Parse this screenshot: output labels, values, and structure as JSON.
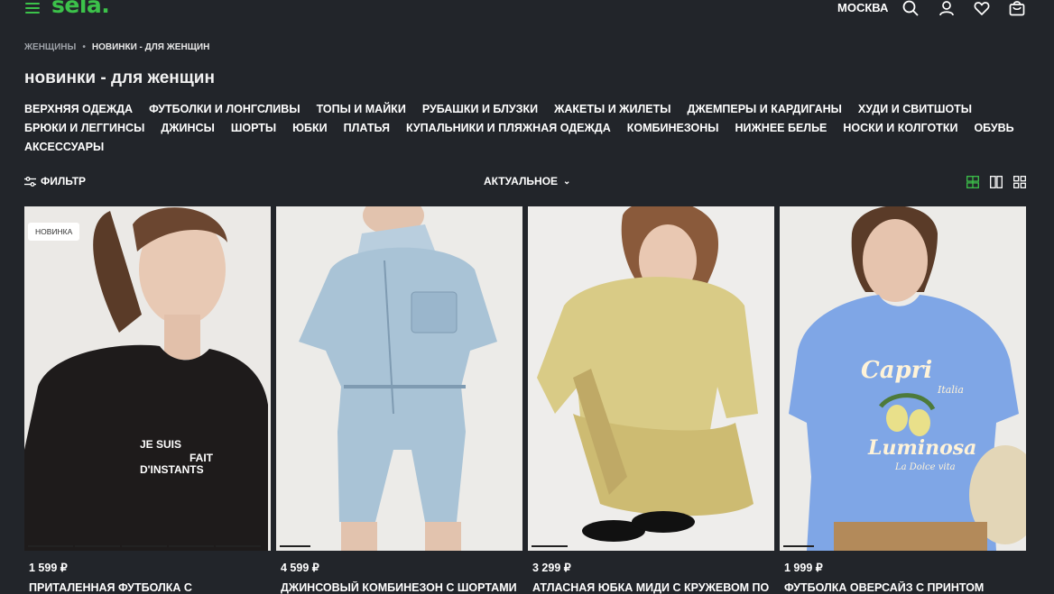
{
  "header": {
    "logo": "sela.",
    "city": "МОСКВА",
    "icons": [
      "burger-menu-icon",
      "search-icon",
      "user-icon",
      "heart-icon",
      "bag-icon"
    ],
    "accent_color": "#3cc24a"
  },
  "breadcrumb": {
    "items": [
      "ЖЕНЩИНЫ",
      "НОВИНКИ - ДЛЯ ЖЕНЩИН"
    ],
    "separator": "•"
  },
  "page_title": "новинки - для женщин",
  "categories": {
    "row1": [
      "ВЕРХНЯЯ ОДЕЖДА",
      "ФУТБОЛКИ И ЛОНГСЛИВЫ",
      "ТОПЫ И МАЙКИ",
      "РУБАШКИ И БЛУЗКИ",
      "ЖАКЕТЫ И ЖИЛЕТЫ",
      "ДЖЕМПЕРЫ И КАРДИГАНЫ",
      "ХУДИ И СВИТШОТЫ"
    ],
    "row2": [
      "БРЮКИ И ЛЕГГИНСЫ",
      "ДЖИНСЫ",
      "ШОРТЫ",
      "ЮБКИ",
      "ПЛАТЬЯ",
      "КУПАЛЬНИКИ И ПЛЯЖНАЯ ОДЕЖДА",
      "КОМБИНЕЗОНЫ",
      "НИЖНЕЕ БЕЛЬЕ",
      "НОСКИ И КОЛГОТКИ",
      "ОБУВЬ"
    ],
    "row3": [
      "АКСЕССУАРЫ"
    ]
  },
  "toolbar": {
    "filter_label": "ФИЛЬТР",
    "sort_label": "АКТУАЛЬНОЕ",
    "view_icons": [
      "grid-2x2-icon",
      "grid-2col-icon",
      "grid-4-icon"
    ]
  },
  "products": [
    {
      "badge": "НОВИНКА",
      "price": "1 599 ₽",
      "name": "ПРИТАЛЕННАЯ ФУТБОЛКА С",
      "print_text": "JE SUIS FAIT D'INSTANTS",
      "color": "#1e1b1b"
    },
    {
      "badge": "",
      "price": "4 599 ₽",
      "name": "ДЖИНСОВЫЙ КОМБИНЕЗОН С ШОРТАМИ",
      "print_text": "",
      "color": "#a9c3d6"
    },
    {
      "badge": "",
      "price": "3 299 ₽",
      "name": "АТЛАСНАЯ ЮБКА МИДИ С КРУЖЕВОМ ПО",
      "print_text": "",
      "color": "#d9cb86"
    },
    {
      "badge": "",
      "price": "1 999 ₽",
      "name": "ФУТБОЛКА ОВЕРСАЙЗ С ПРИНТОМ",
      "print_text": "Capri Italia Luminosa La Dolce vita",
      "color": "#7fa6e6"
    }
  ]
}
